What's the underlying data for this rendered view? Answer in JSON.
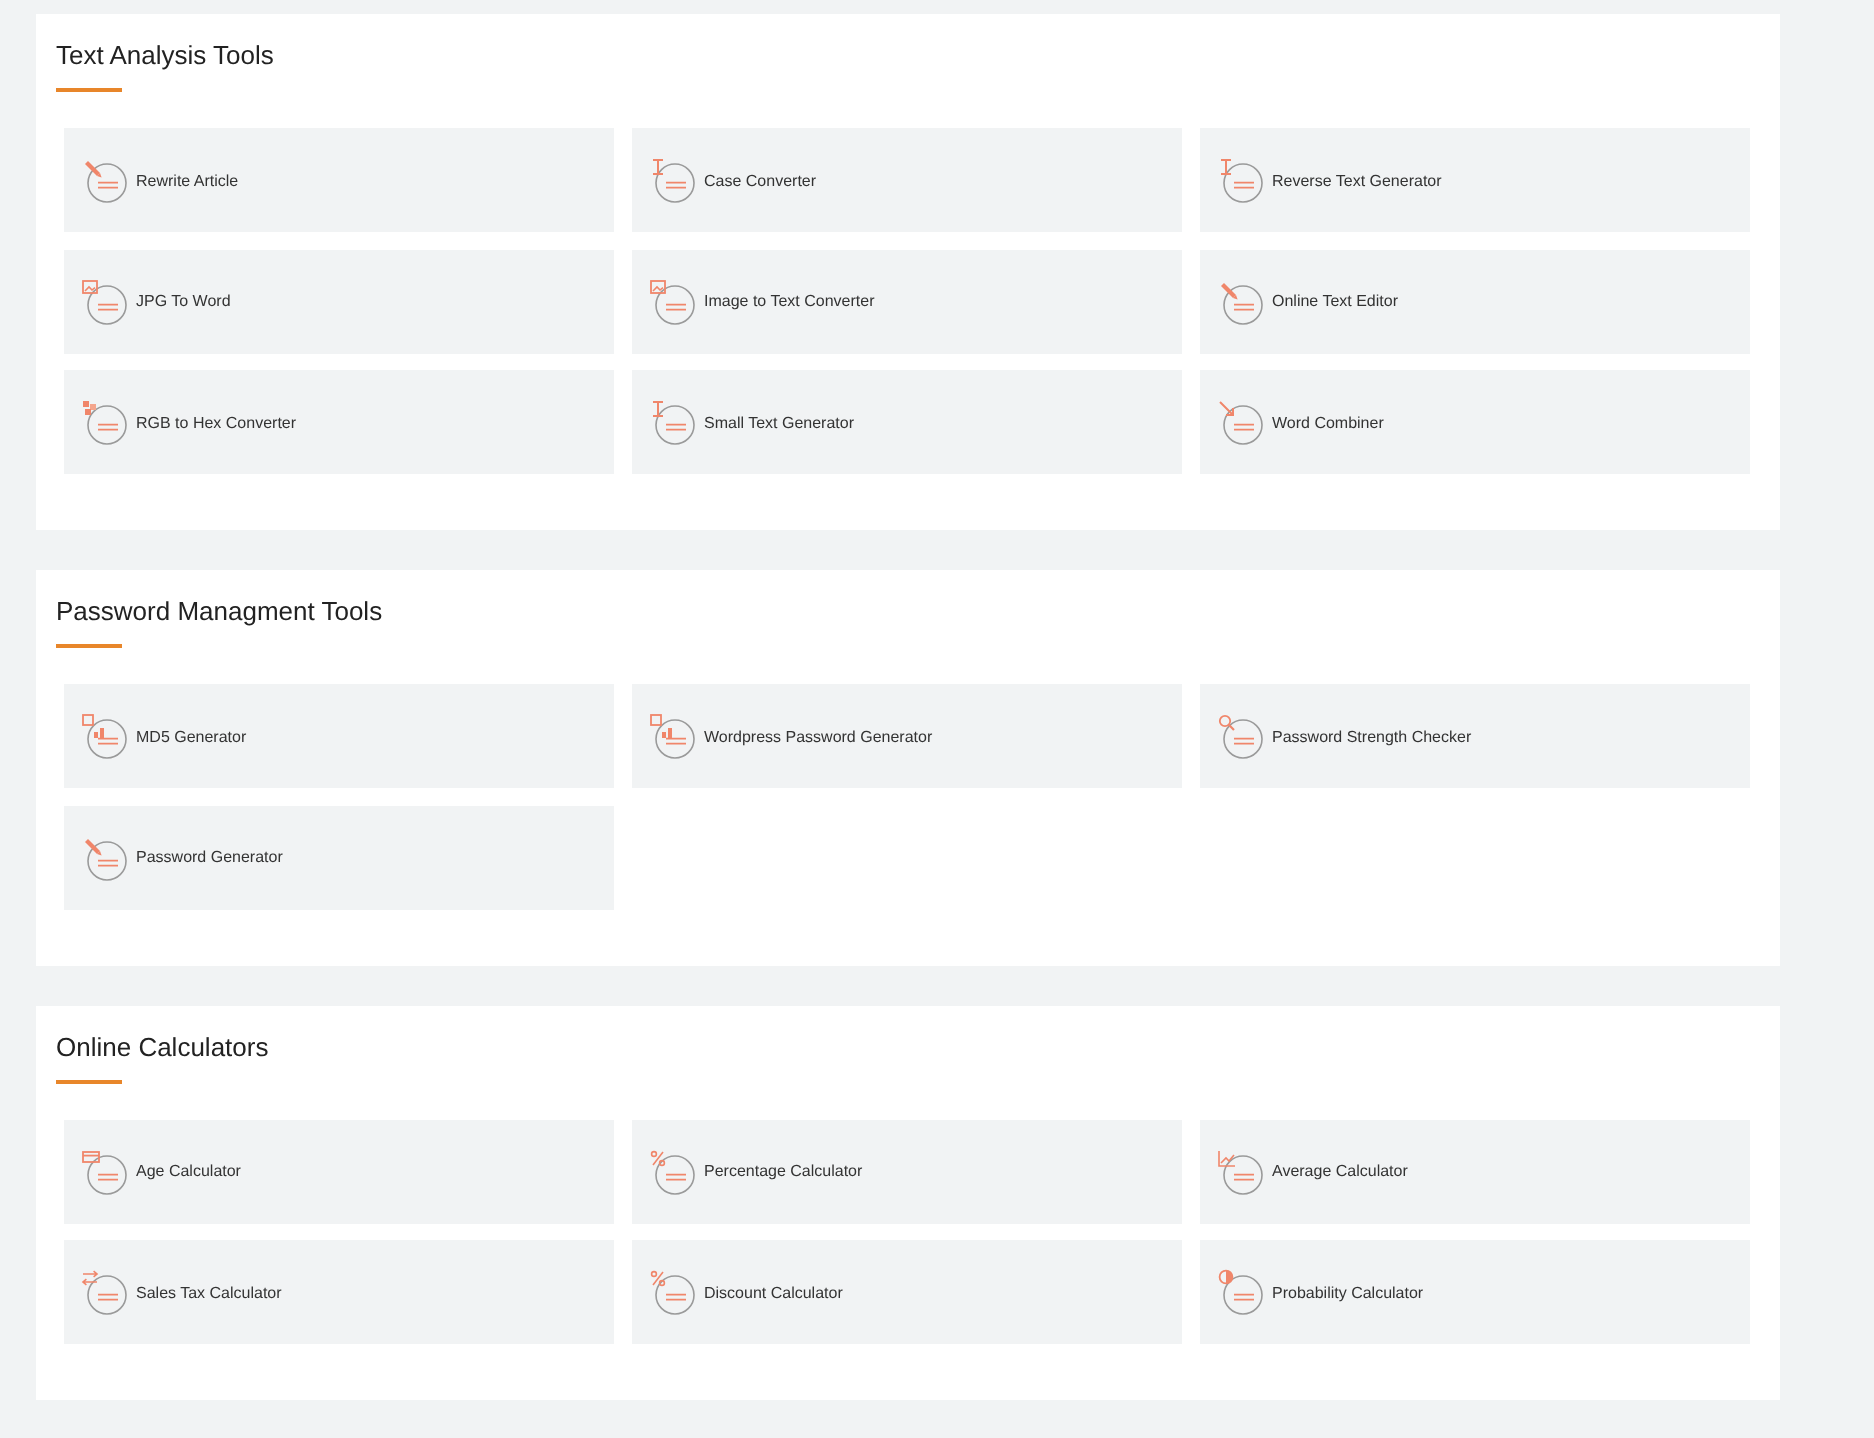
{
  "sections": [
    {
      "title": "Text Analysis Tools",
      "tools": [
        {
          "label": "Rewrite Article"
        },
        {
          "label": "Case Converter"
        },
        {
          "label": "Reverse Text Generator"
        },
        {
          "label": "JPG To Word"
        },
        {
          "label": "Image to Text Converter"
        },
        {
          "label": "Online Text Editor"
        },
        {
          "label": "RGB to Hex Converter"
        },
        {
          "label": "Small Text Generator"
        },
        {
          "label": "Word Combiner"
        }
      ]
    },
    {
      "title": "Password Managment Tools",
      "tools": [
        {
          "label": "MD5 Generator"
        },
        {
          "label": "Wordpress Password Generator"
        },
        {
          "label": "Password Strength Checker"
        },
        {
          "label": "Password Generator"
        }
      ]
    },
    {
      "title": "Online Calculators",
      "tools": [
        {
          "label": "Age Calculator"
        },
        {
          "label": "Percentage Calculator"
        },
        {
          "label": "Average Calculator"
        },
        {
          "label": "Sales Tax Calculator"
        },
        {
          "label": "Discount Calculator"
        },
        {
          "label": "Probability Calculator"
        }
      ]
    }
  ]
}
